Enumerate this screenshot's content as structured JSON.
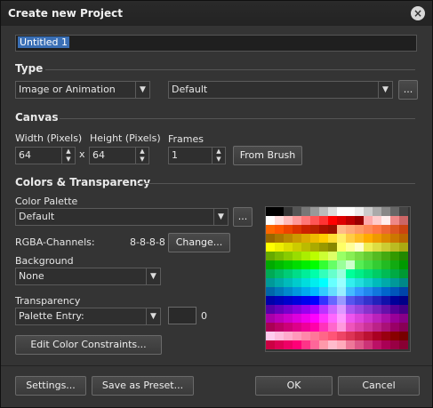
{
  "window": {
    "title": "Create new Project"
  },
  "project_name": "Untitled 1",
  "type_section": {
    "label": "Type",
    "kind_value": "Image or Animation",
    "preset_value": "Default",
    "more_label": "..."
  },
  "canvas": {
    "label": "Canvas",
    "width_label": "Width (Pixels)",
    "height_label": "Height (Pixels)",
    "frames_label": "Frames",
    "width": "64",
    "height": "64",
    "times": "x",
    "frames": "1",
    "from_brush_label": "From Brush"
  },
  "colors": {
    "label": "Colors & Transparency",
    "palette_label": "Color Palette",
    "palette_value": "Default",
    "palette_more": "...",
    "rgba_label": "RGBA-Channels:",
    "rgba_value": "8-8-8-8",
    "change_label": "Change...",
    "background_label": "Background",
    "background_value": "None",
    "transparency_label": "Transparency",
    "transparency_value": "Palette Entry:",
    "transparency_index": "0",
    "constraints_label": "Edit Color Constraints..."
  },
  "footer": {
    "settings_label": "Settings...",
    "save_preset_label": "Save as Preset...",
    "ok_label": "OK",
    "cancel_label": "Cancel"
  },
  "palette_rows": [
    [
      "#000000",
      "#000000",
      "#333333",
      "#555555",
      "#777777",
      "#999999",
      "#bbbbbb",
      "#dddddd",
      "#ffffff",
      "#ffffff",
      "#eeeeee",
      "#cccccc",
      "#aaaaaa",
      "#888888",
      "#666666",
      "#444444"
    ],
    [
      "#ffffff",
      "#ffdddd",
      "#ffbbbb",
      "#ff9999",
      "#ff7777",
      "#ff5555",
      "#ff3333",
      "#ff0000",
      "#dd0000",
      "#bb0000",
      "#990000",
      "#ffaaaa",
      "#ffcccc",
      "#ffeeee",
      "#ee8888",
      "#cc6666"
    ],
    [
      "#ff6600",
      "#ff5500",
      "#ee4400",
      "#dd3300",
      "#cc2200",
      "#bb2200",
      "#aa1100",
      "#991100",
      "#ffbb88",
      "#ffaa77",
      "#ff9966",
      "#ff8855",
      "#ff7744",
      "#ee6633",
      "#dd5522",
      "#cc4411"
    ],
    [
      "#996600",
      "#aa7700",
      "#bb8800",
      "#cc9900",
      "#ddaa00",
      "#eebb00",
      "#ffcc00",
      "#ffdd33",
      "#ffee66",
      "#ffcc44",
      "#ffbb22",
      "#ffaa00",
      "#ee9900",
      "#dd8800",
      "#cc7700",
      "#bb6600"
    ],
    [
      "#ffff00",
      "#eeee00",
      "#dddd00",
      "#cccc00",
      "#bbbb00",
      "#aaaa00",
      "#999900",
      "#888800",
      "#ffff66",
      "#ffff99",
      "#ffffcc",
      "#eeee55",
      "#dddd44",
      "#cccc33",
      "#bbbb22",
      "#aaaa11"
    ],
    [
      "#66aa00",
      "#77bb00",
      "#88cc00",
      "#99dd00",
      "#aaee00",
      "#bbff00",
      "#ccff33",
      "#ddff66",
      "#99ff66",
      "#88ee55",
      "#77dd44",
      "#66cc33",
      "#55bb22",
      "#44aa11",
      "#339900",
      "#228800"
    ],
    [
      "#00aa00",
      "#00bb00",
      "#00cc00",
      "#00dd00",
      "#00ee00",
      "#00ff00",
      "#33ff33",
      "#66ff66",
      "#99ff99",
      "#ccffcc",
      "#55ee55",
      "#44dd44",
      "#33cc33",
      "#22bb22",
      "#11aa11",
      "#009900"
    ],
    [
      "#00aa55",
      "#00bb66",
      "#00cc77",
      "#00dd88",
      "#00ee99",
      "#00ffaa",
      "#33ffbb",
      "#66ffcc",
      "#99ffdd",
      "#00ff99",
      "#00ee88",
      "#00dd77",
      "#00cc66",
      "#00bb55",
      "#00aa44",
      "#009933"
    ],
    [
      "#009999",
      "#00aaaa",
      "#00bbbb",
      "#00cccc",
      "#00dddd",
      "#00eeee",
      "#00ffff",
      "#66ffff",
      "#99ffff",
      "#33eeee",
      "#22dddd",
      "#11cccc",
      "#00bbbb",
      "#00aaaa",
      "#009999",
      "#008888"
    ],
    [
      "#0066aa",
      "#0077bb",
      "#0088cc",
      "#0099dd",
      "#00aaee",
      "#00bbff",
      "#33ccff",
      "#66ddff",
      "#99eeff",
      "#44bbff",
      "#3399ff",
      "#2288ee",
      "#1177dd",
      "#0066cc",
      "#0055bb",
      "#0044aa"
    ],
    [
      "#0000aa",
      "#0000bb",
      "#0000cc",
      "#0000dd",
      "#0000ee",
      "#0000ff",
      "#3333ff",
      "#6666ff",
      "#9999ff",
      "#5555ee",
      "#4444dd",
      "#3333cc",
      "#2222bb",
      "#1111aa",
      "#000099",
      "#000088"
    ],
    [
      "#5500aa",
      "#6600bb",
      "#7700cc",
      "#8800dd",
      "#9900ee",
      "#aa00ff",
      "#bb33ff",
      "#cc66ff",
      "#dd99ff",
      "#aa55ee",
      "#9944dd",
      "#8833cc",
      "#7722bb",
      "#6611aa",
      "#550099",
      "#440088"
    ],
    [
      "#aa00aa",
      "#bb00bb",
      "#cc00cc",
      "#dd00dd",
      "#ee00ee",
      "#ff00ff",
      "#ff33ff",
      "#ff66ff",
      "#ff99ff",
      "#ee55ee",
      "#dd44dd",
      "#cc33cc",
      "#bb22bb",
      "#aa11aa",
      "#990099",
      "#880088"
    ],
    [
      "#aa0055",
      "#bb0066",
      "#cc0077",
      "#dd0088",
      "#ee0099",
      "#ff00aa",
      "#ff33bb",
      "#ff66cc",
      "#ff99dd",
      "#ee55bb",
      "#dd44aa",
      "#cc3399",
      "#bb2288",
      "#aa1177",
      "#990066",
      "#880055"
    ],
    [
      "#ffccee",
      "#ffbbdd",
      "#ffaacc",
      "#ff99bb",
      "#ff88aa",
      "#ff7799",
      "#ff6688",
      "#ff5577",
      "#ee4466",
      "#dd3355",
      "#cc2244",
      "#bb1133",
      "#aa0022",
      "#990011",
      "#880000",
      "#770000"
    ],
    [
      "#cc0044",
      "#dd0055",
      "#ee0066",
      "#ff0077",
      "#ff3388",
      "#ff6699",
      "#ff99aa",
      "#ffbbcc",
      "#ffaabb",
      "#ee7799",
      "#dd5588",
      "#cc3377",
      "#bb1166",
      "#aa0055",
      "#990044",
      "#880033"
    ]
  ]
}
